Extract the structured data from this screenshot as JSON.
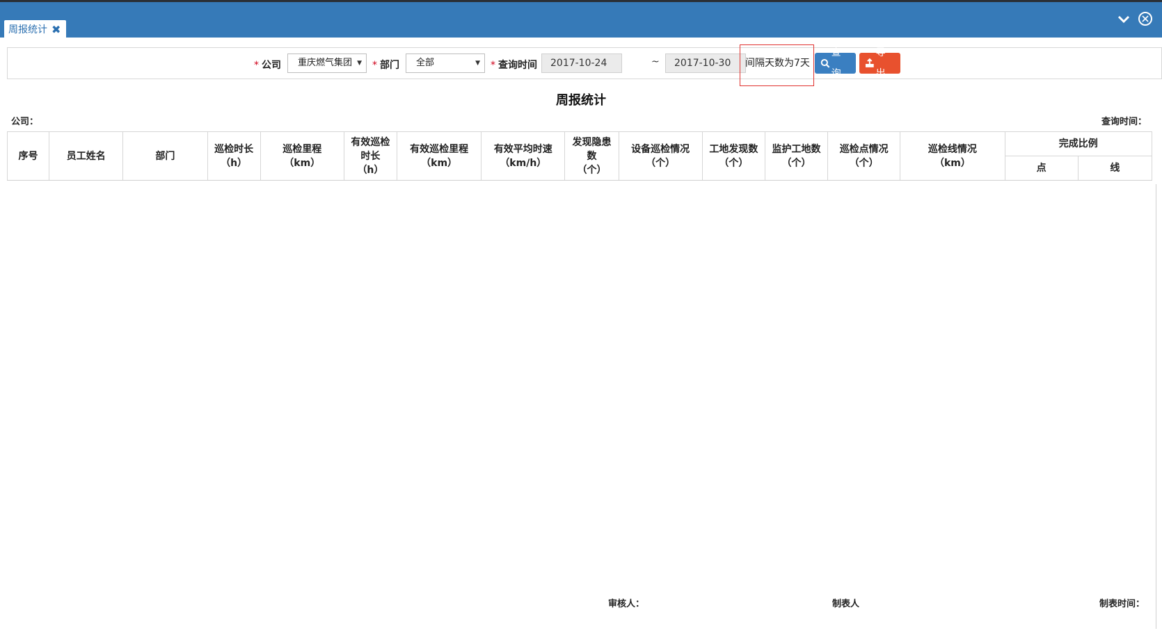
{
  "window": {
    "tab_label": "周报统计",
    "tab_close": "✖",
    "collapse_glyph": "⌄",
    "close_glyph": "✕"
  },
  "query": {
    "company_label": "公司",
    "company_value": "重庆燃气集团",
    "department_label": "部门",
    "department_value": "全部",
    "time_label": "查询时间",
    "start_date": "2017-10-24",
    "separator": "~",
    "end_date": "2017-10-30",
    "interval_text": "间隔天数为7天",
    "query_button": "查询",
    "export_button": "导出",
    "required_mark": "*"
  },
  "report": {
    "title": "周报统计",
    "company_meta": "公司：",
    "query_time_meta": "查询时间："
  },
  "table": {
    "headers": {
      "index": "序号",
      "employee": "员工姓名",
      "department": "部门",
      "patrol_duration": [
        "巡检时长",
        "（h）"
      ],
      "patrol_mileage": [
        "巡检里程",
        "（km）"
      ],
      "effective_duration": [
        "有效巡检",
        "时长",
        "（h）"
      ],
      "effective_mileage": [
        "有效巡检里程",
        "（km）"
      ],
      "effective_speed": [
        "有效平均时速",
        "（km/h）"
      ],
      "hazards_found": [
        "发现隐患",
        "数",
        "（个）"
      ],
      "equipment_patrol": [
        "设备巡检情况",
        "（个）"
      ],
      "sites_found": [
        "工地发现数",
        "（个）"
      ],
      "sites_monitored": [
        "监护工地数",
        "（个）"
      ],
      "patrol_points": [
        "巡检点情况",
        "（个）"
      ],
      "patrol_lines": [
        "巡检线情况",
        "（km）"
      ],
      "completion_ratio": "完成比例",
      "ratio_point": "点",
      "ratio_line": "线"
    }
  },
  "footer": {
    "reviewer": "审核人：",
    "preparer": "制表人",
    "prepared_time": "制表时间："
  }
}
